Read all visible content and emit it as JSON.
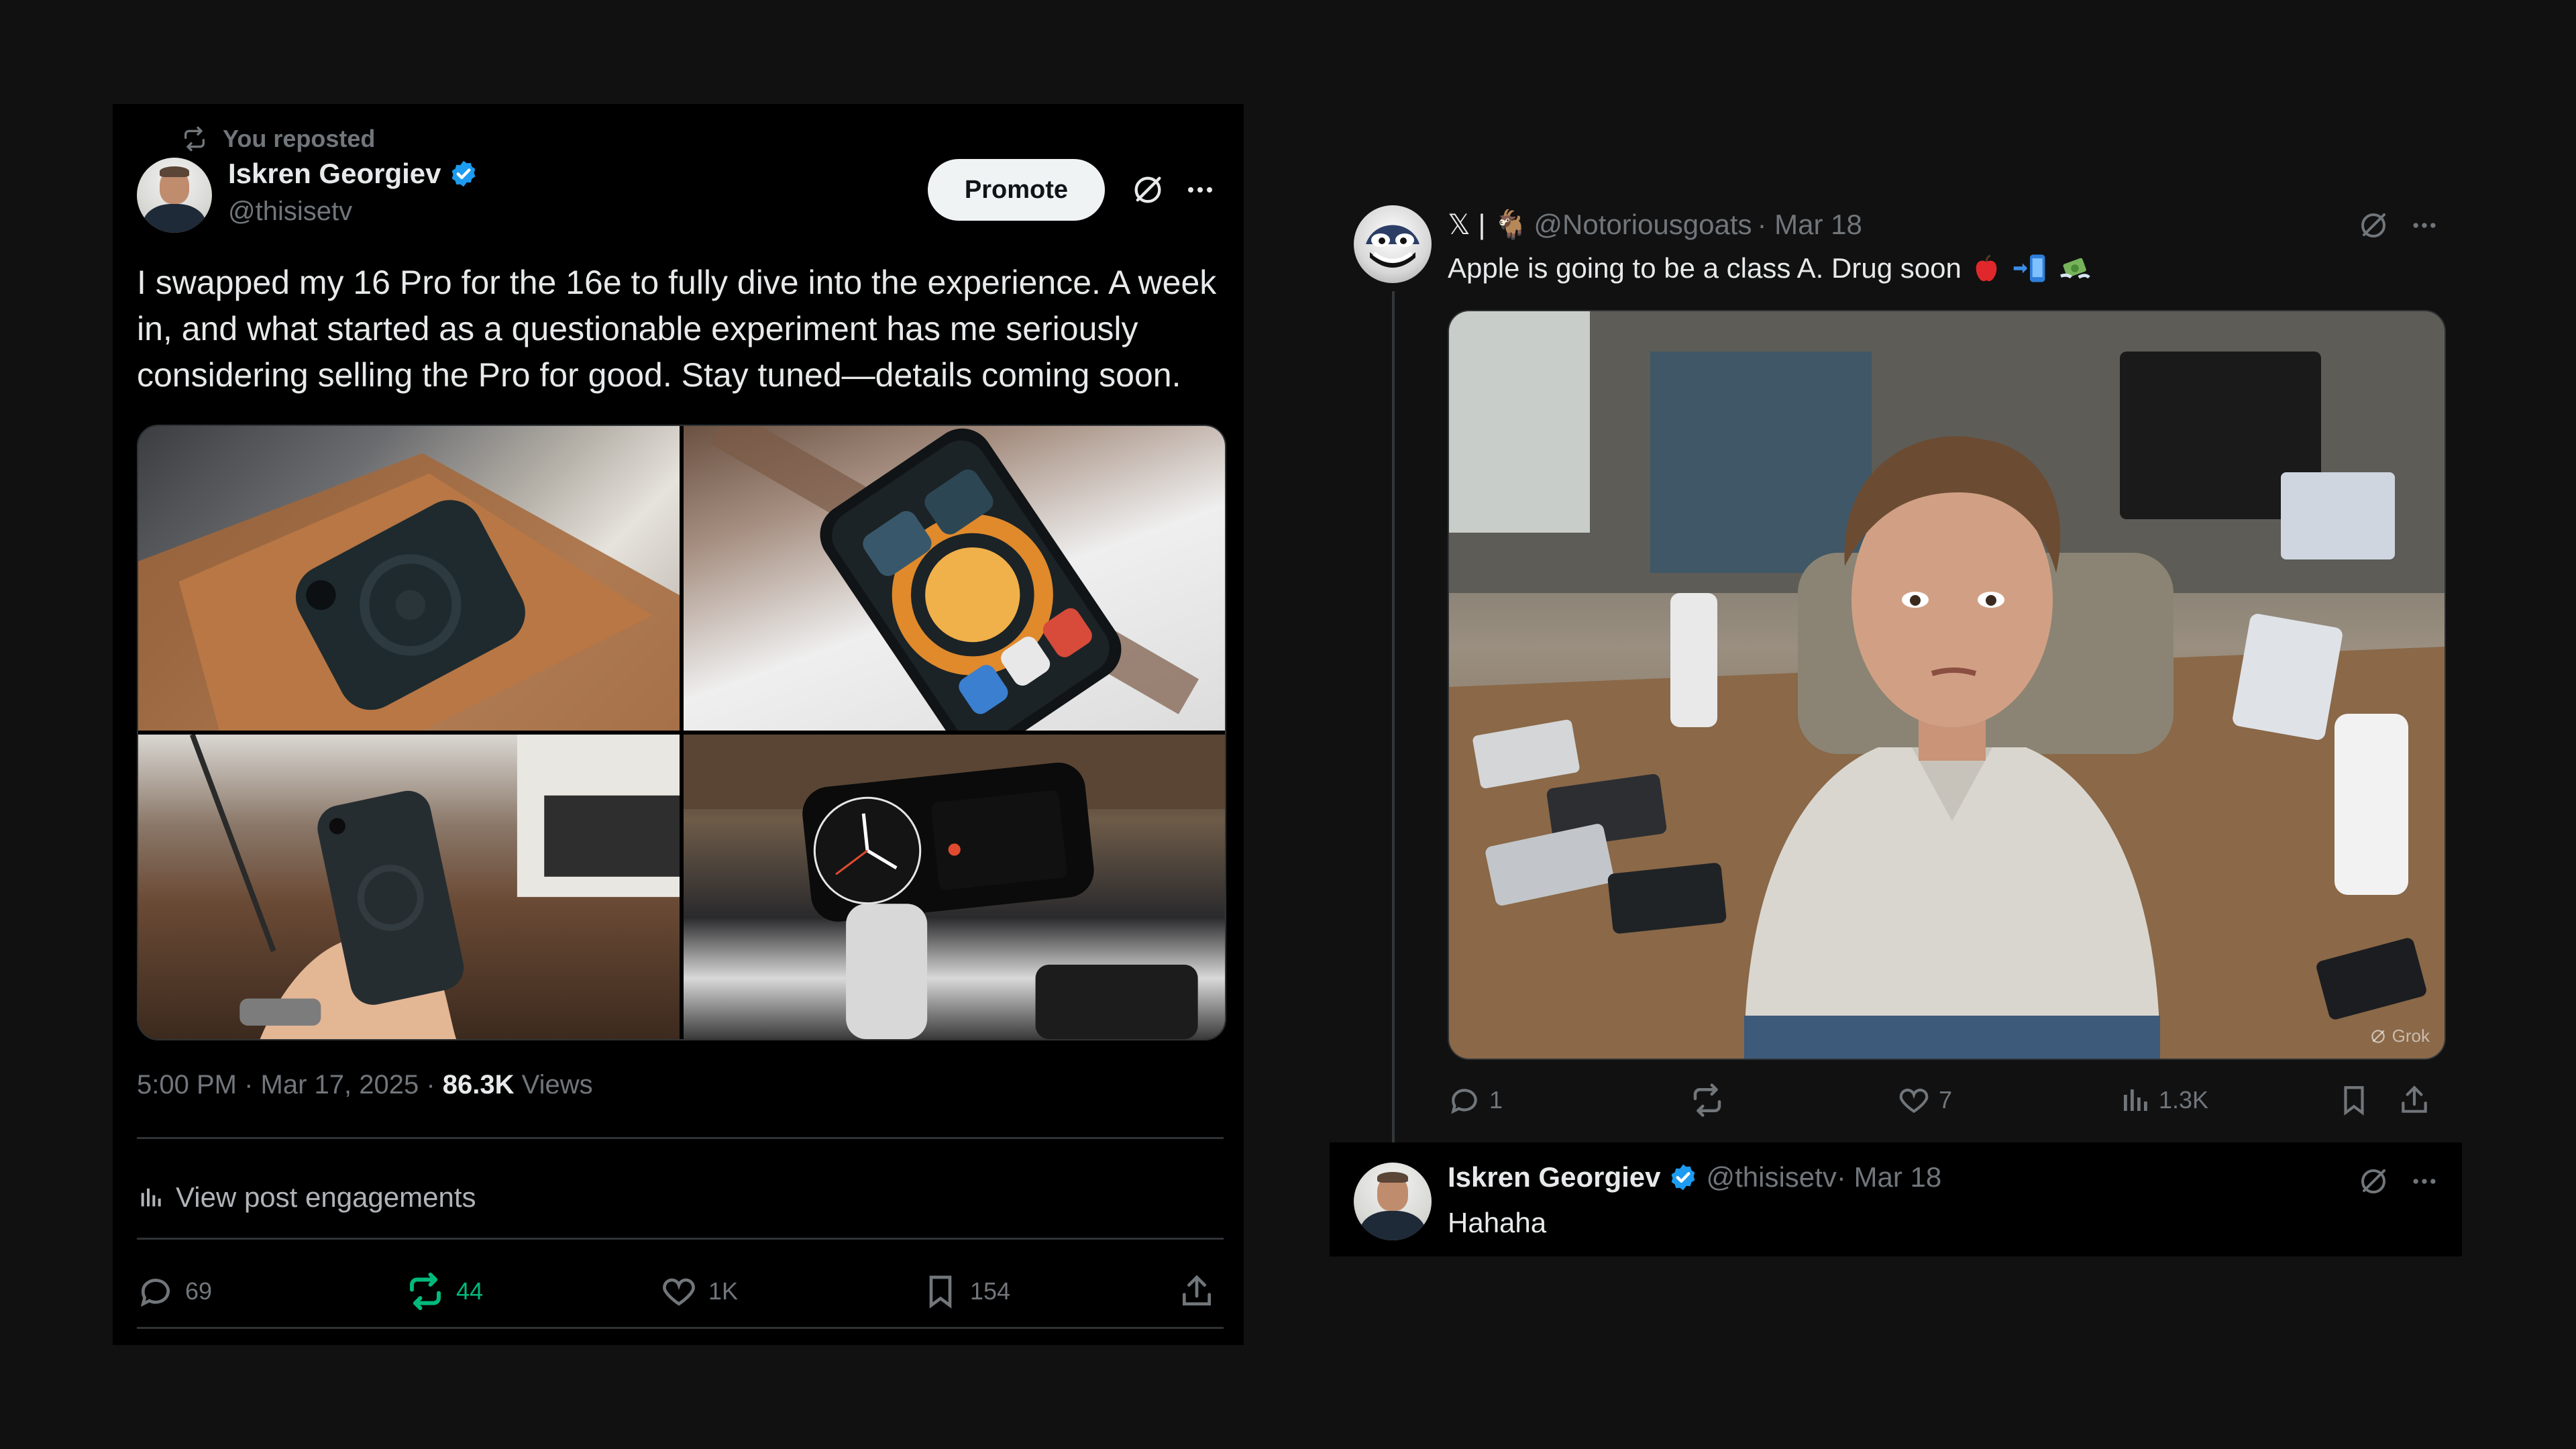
{
  "left_post": {
    "repost_label": "You reposted",
    "author": {
      "name": "Iskren Georgiev",
      "handle": "@thisisetv",
      "verified": true
    },
    "promote_label": "Promote",
    "text": "I swapped my 16 Pro for the 16e to fully dive into the experience. A week in, and what started as a questionable experiment has me seriously considering selling the Pro for good. Stay tuned—details coming soon.",
    "timestamp": "5:00 PM · Mar 17, 2025 · ",
    "views_count": "86.3K",
    "views_label": " Views",
    "engagements_label": "View post engagements",
    "stats": {
      "replies": "69",
      "reposts": "44",
      "likes": "1K",
      "bookmarks": "154"
    },
    "reposted_color": "#00ba7c"
  },
  "reply_post": {
    "display_name": "𝕏 | 🐐",
    "handle": "@Notoriousgoats",
    "date": " · Mar 18",
    "text": "Apple is going to be a class A. Drug soon",
    "emojis": [
      "apple",
      "phone-arrow",
      "money-wings"
    ],
    "watermark": "Grok",
    "stats": {
      "replies": "1",
      "reposts": "",
      "likes": "7",
      "views": "1.3K"
    }
  },
  "self_reply": {
    "author": {
      "name": "Iskren Georgiev",
      "handle": "@thisisetv",
      "verified": true
    },
    "date": " · Mar 18",
    "text": "Hahaha"
  },
  "colors": {
    "background": "#111111",
    "card": "#000000",
    "text": "#e7e9ea",
    "muted": "#71767b",
    "verified": "#1d9bf0"
  }
}
